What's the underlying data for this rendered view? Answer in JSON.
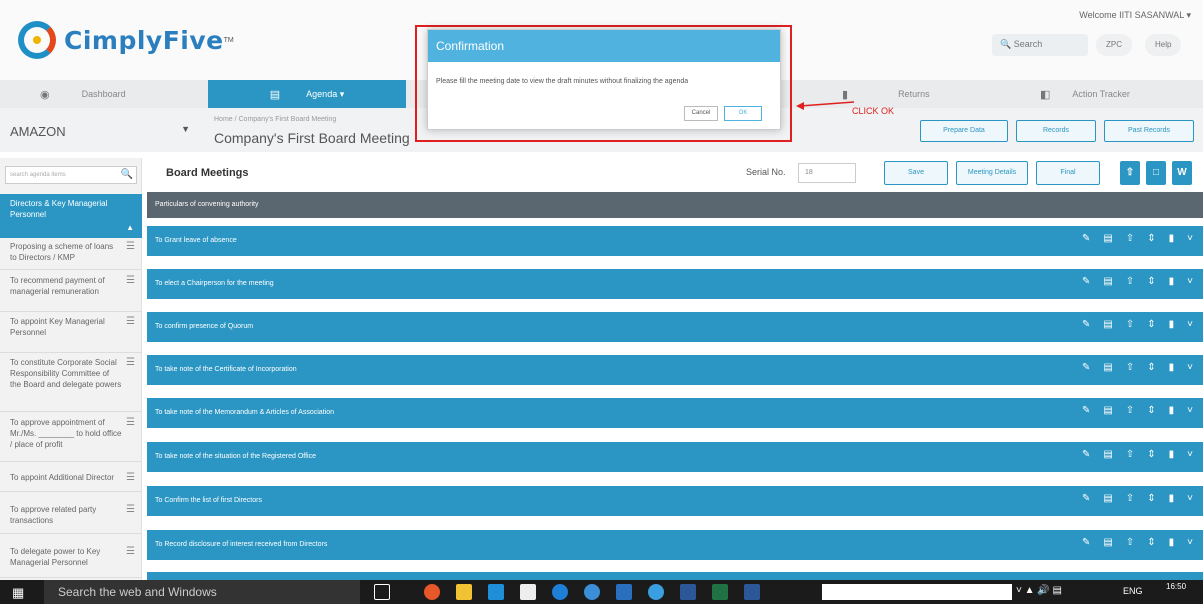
{
  "header": {
    "logo_text": "CimplyFive",
    "welcome": "Welcome IITI SASANWAL ▾",
    "search_placeholder": "Search",
    "chip1": "ZPC",
    "chip2": "Help"
  },
  "nav": {
    "dashboard": "Dashboard",
    "agenda": "Agenda ▾",
    "returns": "Returns",
    "action_tracker": "Action Tracker"
  },
  "company": {
    "name": "AMAZON",
    "breadcrumb": "Home / Company's First Board Meeting",
    "meeting_title": "Company's First Board Meeting",
    "btn_prepare": "Prepare Data",
    "btn_records": "Records",
    "btn_past": "Past Records"
  },
  "sidebar": {
    "search_placeholder": "search agenda items",
    "active_section": "Directors & Key Managerial Personnel",
    "items": [
      "Proposing a scheme of loans to Directors / KMP",
      "To recommend payment of managerial remuneration",
      "To appoint Key Managerial Personnel",
      "To constitute Corporate Social Responsibility Committee of the Board and delegate powers",
      "To approve appointment of Mr./Ms. ________ to hold office / place of profit",
      "To appoint Additional Director",
      "To approve related party transactions",
      "To delegate power to Key Managerial Personnel"
    ]
  },
  "main": {
    "title": "Board Meetings",
    "serial_label": "Serial No.",
    "serial_value": "18",
    "btn_save": "Save",
    "btn_meeting_details": "Meeting Details",
    "btn_final": "Final",
    "convening": "Particulars of convening authority",
    "rows": [
      "To Grant leave of absence",
      "To elect a Chairperson for the meeting",
      "To confirm presence of Quorum",
      "To take note of the Certificate of Incorporation",
      "To take note of the Memorandum & Articles of Association",
      "To take note of the situation of the Registered Office",
      "To Confirm the list of first Directors",
      "To Record disclosure of interest received from Directors"
    ]
  },
  "modal": {
    "title": "Confirmation",
    "message": "Please fill the meeting date to view the draft minutes without finalizing the agenda",
    "cancel": "Cancel",
    "ok": "OK"
  },
  "annotation": "CLICK OK",
  "taskbar": {
    "search": "Search the web and Windows",
    "lang": "ENG",
    "time": "16:50"
  },
  "colors": {
    "accent": "#2b96c3",
    "annotation": "#e02020"
  }
}
